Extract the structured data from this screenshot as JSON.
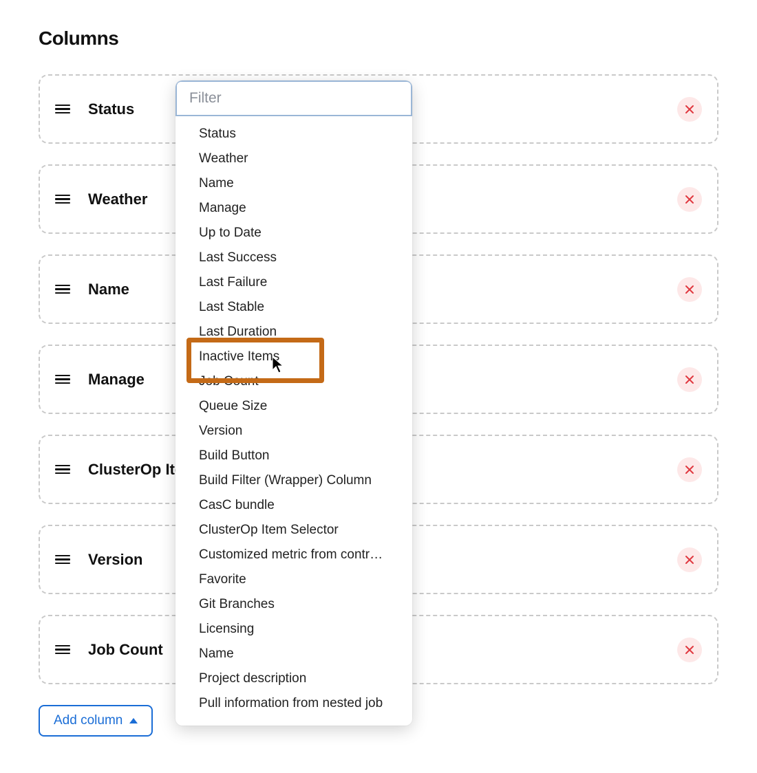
{
  "section_title": "Columns",
  "rows": [
    {
      "label": "Status"
    },
    {
      "label": "Weather"
    },
    {
      "label": "Name"
    },
    {
      "label": "Manage"
    },
    {
      "label": "ClusterOp Item Selector"
    },
    {
      "label": "Version"
    },
    {
      "label": "Job Count"
    }
  ],
  "add_button_label": "Add column",
  "dropdown": {
    "filter_placeholder": "Filter",
    "options": [
      "Status",
      "Weather",
      "Name",
      "Manage",
      "Up to Date",
      "Last Success",
      "Last Failure",
      "Last Stable",
      "Last Duration",
      "Inactive Items",
      "Job Count",
      "Queue Size",
      "Version",
      "Build Button",
      "Build Filter (Wrapper) Column",
      "CasC bundle",
      "ClusterOp Item Selector",
      "Customized metric from controller",
      "Favorite",
      "Git Branches",
      "Licensing",
      "Name",
      "Project description",
      "Pull information from nested job"
    ],
    "highlighted_option": "Inactive Items"
  },
  "colors": {
    "accent": "#1a6dd6",
    "danger": "#e03940",
    "highlight_border": "#c46a17"
  }
}
